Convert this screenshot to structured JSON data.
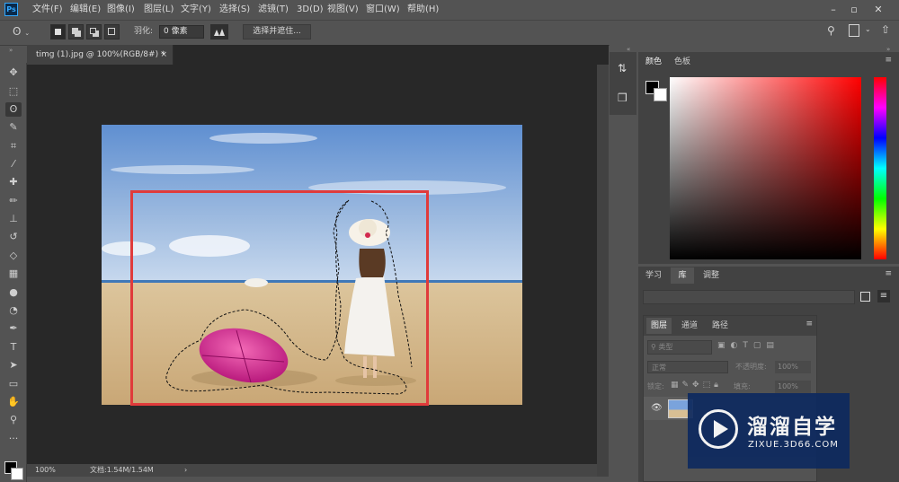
{
  "app": {
    "logo": "Ps"
  },
  "menu": [
    "文件(F)",
    "编辑(E)",
    "图像(I)",
    "图层(L)",
    "文字(Y)",
    "选择(S)",
    "滤镜(T)",
    "3D(D)",
    "视图(V)",
    "窗口(W)",
    "帮助(H)"
  ],
  "window_controls": {
    "minimize": "–",
    "restore": "▫",
    "close": "✕"
  },
  "options": {
    "feather_label": "羽化:",
    "feather_value": "0 像素",
    "select_mask": "选择并遮住..."
  },
  "document": {
    "tab_title": "timg (1).jpg @ 100%(RGB/8#) *",
    "tab_close": "×",
    "zoom": "100%",
    "doc_info": "文档:1.54M/1.54M",
    "status_arrow": "›"
  },
  "tools": [
    {
      "name": "move-tool-icon",
      "glyph": "✥"
    },
    {
      "name": "marquee-tool-icon",
      "glyph": "⬚"
    },
    {
      "name": "lasso-tool-icon",
      "glyph": "ʘ"
    },
    {
      "name": "quick-select-tool-icon",
      "glyph": "✎"
    },
    {
      "name": "crop-tool-icon",
      "glyph": "⌗"
    },
    {
      "name": "eyedropper-tool-icon",
      "glyph": "⁄"
    },
    {
      "name": "healing-brush-tool-icon",
      "glyph": "✚"
    },
    {
      "name": "brush-tool-icon",
      "glyph": "✏"
    },
    {
      "name": "clone-stamp-tool-icon",
      "glyph": "⊥"
    },
    {
      "name": "history-brush-tool-icon",
      "glyph": "↺"
    },
    {
      "name": "eraser-tool-icon",
      "glyph": "◇"
    },
    {
      "name": "gradient-tool-icon",
      "glyph": "▦"
    },
    {
      "name": "blur-tool-icon",
      "glyph": "●"
    },
    {
      "name": "dodge-tool-icon",
      "glyph": "◔"
    },
    {
      "name": "pen-tool-icon",
      "glyph": "✒"
    },
    {
      "name": "type-tool-icon",
      "glyph": "T"
    },
    {
      "name": "path-select-tool-icon",
      "glyph": "➤"
    },
    {
      "name": "rectangle-tool-icon",
      "glyph": "▭"
    },
    {
      "name": "hand-tool-icon",
      "glyph": "✋"
    },
    {
      "name": "zoom-tool-icon",
      "glyph": "⚲"
    },
    {
      "name": "more-tools-icon",
      "glyph": "···"
    }
  ],
  "color_panel": {
    "tabs": [
      "颜色",
      "色板"
    ]
  },
  "learn_panel": {
    "tabs": [
      "学习",
      "库",
      "调整"
    ]
  },
  "layers_panel": {
    "tabs": [
      "图层",
      "通道",
      "路径"
    ],
    "filter_label": "类型",
    "blend_mode": "正常",
    "opacity_label": "不透明度:",
    "opacity_value": "100%",
    "lock_label": "锁定:",
    "fill_label": "填充:",
    "fill_value": "100%"
  },
  "watermark": {
    "title": "溜溜自学",
    "url": "ZIXUE.3D66.COM"
  },
  "colors": {
    "highlight": "#e03b3b",
    "accent": "#31a8ff",
    "umbrella": "#d4148f"
  }
}
